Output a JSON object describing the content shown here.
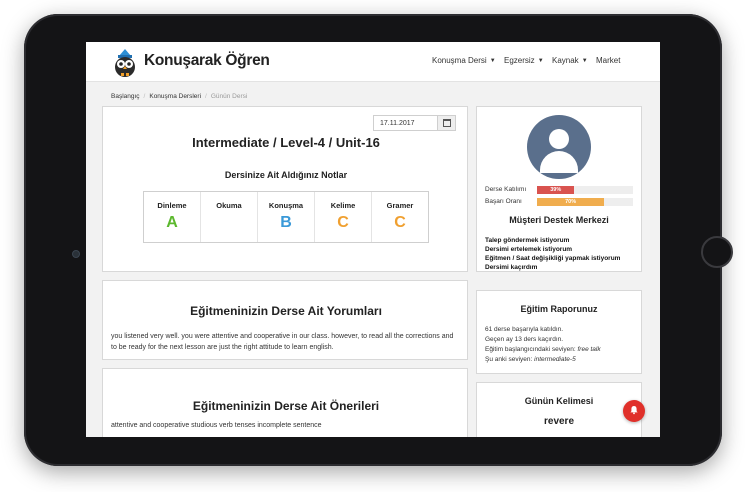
{
  "brand": {
    "name": "Konuşarak Öğren"
  },
  "nav": {
    "items": [
      {
        "label": "Konuşma Dersi",
        "dropdown": true
      },
      {
        "label": "Egzersiz",
        "dropdown": true
      },
      {
        "label": "Kaynak",
        "dropdown": true
      },
      {
        "label": "Market",
        "dropdown": false
      }
    ]
  },
  "breadcrumb": [
    "Başlangıç",
    "Konuşma Dersleri",
    "Günün Dersi"
  ],
  "lesson": {
    "date": "17.11.2017",
    "title": "Intermediate / Level-4 / Unit-16",
    "notes_title": "Dersinize Ait Aldığınız Notlar",
    "grades": [
      {
        "skill": "Dinleme",
        "grade": "A",
        "color": "#5cb82e"
      },
      {
        "skill": "Okuma",
        "grade": "",
        "color": "#333333"
      },
      {
        "skill": "Konuşma",
        "grade": "B",
        "color": "#3a99d8"
      },
      {
        "skill": "Kelime",
        "grade": "C",
        "color": "#f0a030"
      },
      {
        "skill": "Gramer",
        "grade": "C",
        "color": "#f0a030"
      }
    ]
  },
  "comments": {
    "title": "Eğitmeninizin Derse Ait Yorumları",
    "text": "you listened very well. you were attentive and cooperative in our class. however, to read all the corrections and to be ready for the next lesson are just the right attitude to learn english."
  },
  "suggestions": {
    "title": "Eğitmeninizin Derse Ait Önerileri",
    "text": "attentive and cooperative studious verb tenses incomplete sentence"
  },
  "profile": {
    "stats": [
      {
        "label": "Derse Katılımı",
        "value": "39%",
        "percent": 39,
        "color": "#d9534f"
      },
      {
        "label": "Başarı Oranı",
        "value": "70%",
        "percent": 70,
        "color": "#f0ad4e"
      }
    ],
    "support_title": "Müşteri Destek Merkezi",
    "support_links": [
      "Talep göndermek istiyorum",
      "Dersimi ertelemek istiyorum",
      "Eğitmen / Saat değişikliği yapmak istiyorum",
      "Dersimi kaçırdım"
    ]
  },
  "report": {
    "title": "Eğitim Raporunuz",
    "line1": "61 derse başarıyla katıldın.",
    "line2": "Geçen ay 13 ders kaçırdın.",
    "line3_label": "Eğitim başlangıcındaki seviyen: ",
    "line3_value": "free talk",
    "line4_label": "Şu anki seviyen: ",
    "line4_value": "intermediate-5"
  },
  "word_of_day": {
    "title": "Günün Kelimesi",
    "word": "revere"
  },
  "colors": {
    "avatar_bg": "#5a6f8c",
    "notification": "#e0302a"
  },
  "icons": [
    "owl-logo-icon",
    "calendar-icon",
    "user-avatar-icon",
    "bell-icon"
  ]
}
